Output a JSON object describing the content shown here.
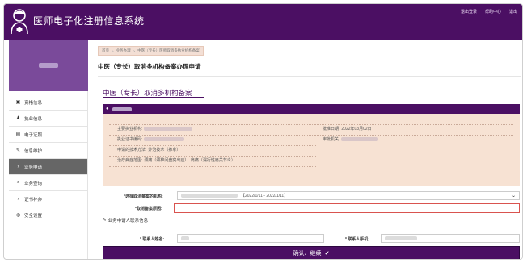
{
  "header": {
    "app_title": "医师电子化注册信息系统",
    "links": [
      "退出登录",
      "帮助中心",
      "退出"
    ]
  },
  "sidebar": {
    "profile_name": "",
    "items": [
      {
        "icon": "folder-icon",
        "glyph": "▣",
        "label": "资格信息",
        "active": false
      },
      {
        "icon": "user-plus-icon",
        "glyph": "♟",
        "label": "执业信息",
        "active": false
      },
      {
        "icon": "document-icon",
        "glyph": "▤",
        "label": "电子证照",
        "active": false
      },
      {
        "icon": "edit-icon",
        "glyph": "✎",
        "label": "信息维护",
        "active": false
      },
      {
        "icon": "chevron-right-icon",
        "glyph": "›",
        "label": "业务申请",
        "active": true
      },
      {
        "icon": "search-icon",
        "glyph": "⌕",
        "label": "业务查询",
        "active": false
      },
      {
        "icon": "chevron-right-icon",
        "glyph": "›",
        "label": "证书补办",
        "active": false
      },
      {
        "icon": "shield-icon",
        "glyph": "◍",
        "label": "安全设置",
        "active": false
      }
    ]
  },
  "breadcrumb": [
    "首页",
    "业务办理",
    "中医（专长）医师取消多执业机构备案"
  ],
  "page_title": "中医（专长）取消多机构备案办理申请",
  "card_title": "中医（专长）取消多机构备案",
  "info": {
    "main_org_label": "主要执业机构:",
    "license_label": "执业证书编码:",
    "skill_label": "申请的技术方法:",
    "skill_value": "外治技术（推拿）",
    "scope_label": "治疗病症范围:",
    "scope_value": "颈痛（颈椎间盘突出症）、肩痛（漏行性肩关节炎）",
    "approve_date_label": "批准日期:",
    "approve_date_value": "2022年03月02日",
    "approve_org_label": "审批机关:"
  },
  "form": {
    "cancel_org_label": "*选择取消备案的机构:",
    "cancel_org_date_range": "【2022/1/11 - 2022/1/11】",
    "reason_label": "*取消备案原因:",
    "contact_section": "业务申请人联系信息",
    "contact_name_label": "* 联系人姓名:",
    "contact_phone_label": "* 联系人手机:",
    "submit_label": "确认、继续"
  },
  "colors": {
    "brand": "#4b0f63",
    "info_bg": "#f7e2d3",
    "active_nav": "#666666",
    "error_border": "#d9534f"
  }
}
